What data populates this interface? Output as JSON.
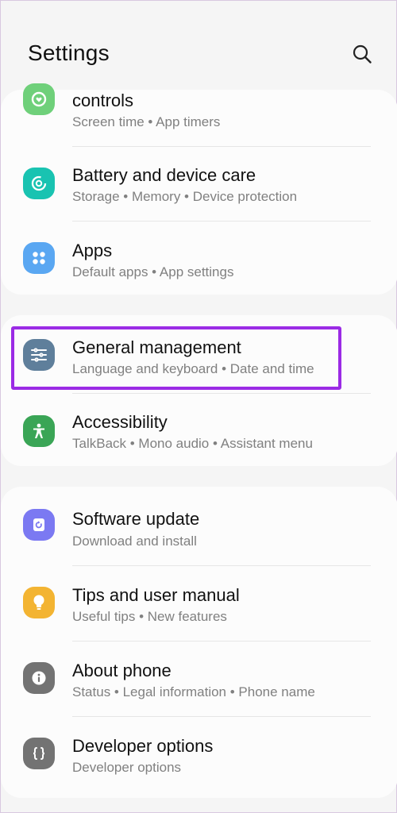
{
  "header": {
    "title": "Settings",
    "search_icon": "search-icon"
  },
  "rows": [
    {
      "name": "digital-wellbeing",
      "title": "controls",
      "subtitle": "Screen time  •  App timers",
      "icon": "heart-circle-icon",
      "color": "#6fd07a"
    },
    {
      "name": "battery-device-care",
      "title": "Battery and device care",
      "subtitle": "Storage  •  Memory  •  Device protection",
      "icon": "device-care-icon",
      "color": "#19c3b1"
    },
    {
      "name": "apps",
      "title": "Apps",
      "subtitle": "Default apps  •  App settings",
      "icon": "apps-grid-icon",
      "color": "#5aa7f2"
    },
    {
      "name": "general-management",
      "title": "General management",
      "subtitle": "Language and keyboard  •  Date and time",
      "icon": "sliders-icon",
      "color": "#5f7f9b"
    },
    {
      "name": "accessibility",
      "title": "Accessibility",
      "subtitle": "TalkBack  •  Mono audio  •  Assistant menu",
      "icon": "accessibility-icon",
      "color": "#3aa556"
    },
    {
      "name": "software-update",
      "title": "Software update",
      "subtitle": "Download and install",
      "icon": "update-icon",
      "color": "#7b79f2"
    },
    {
      "name": "tips-user-manual",
      "title": "Tips and user manual",
      "subtitle": "Useful tips  •  New features",
      "icon": "lightbulb-icon",
      "color": "#f3b432"
    },
    {
      "name": "about-phone",
      "title": "About phone",
      "subtitle": "Status  •  Legal information  •  Phone name",
      "icon": "info-icon",
      "color": "#737373"
    },
    {
      "name": "developer-options",
      "title": "Developer options",
      "subtitle": "Developer options",
      "icon": "braces-icon",
      "color": "#737373"
    }
  ],
  "highlight_color": "#9b2be5"
}
